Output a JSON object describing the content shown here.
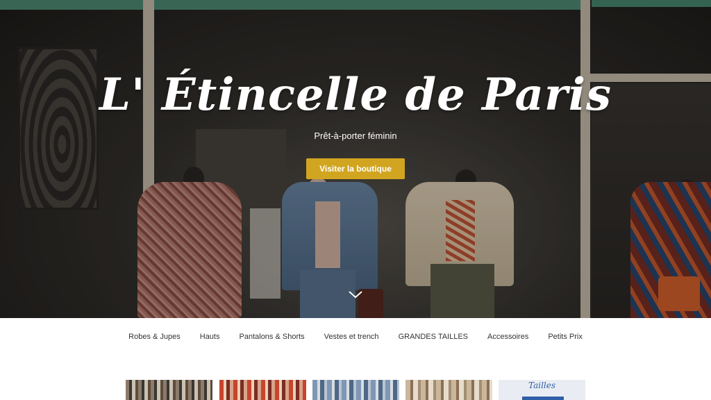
{
  "hero": {
    "title": "L' Étincelle de Paris",
    "subtitle": "Prêt-à-porter féminin",
    "cta_label": "Visiter la boutique",
    "cta_color": "#d2a520",
    "scroll_icon": "chevron-down-icon"
  },
  "categories": {
    "items": [
      {
        "label": "Robes & Jupes"
      },
      {
        "label": "Hauts"
      },
      {
        "label": "Pantalons & Shorts"
      },
      {
        "label": "Vestes et trench"
      },
      {
        "label": "GRANDES TAILLES"
      },
      {
        "label": "Accessoires"
      },
      {
        "label": "Petits Prix"
      }
    ]
  },
  "thumbnails": {
    "items": [
      {
        "label": ""
      },
      {
        "label": ""
      },
      {
        "label": ""
      },
      {
        "label": ""
      },
      {
        "label": "Tailles"
      }
    ]
  }
}
